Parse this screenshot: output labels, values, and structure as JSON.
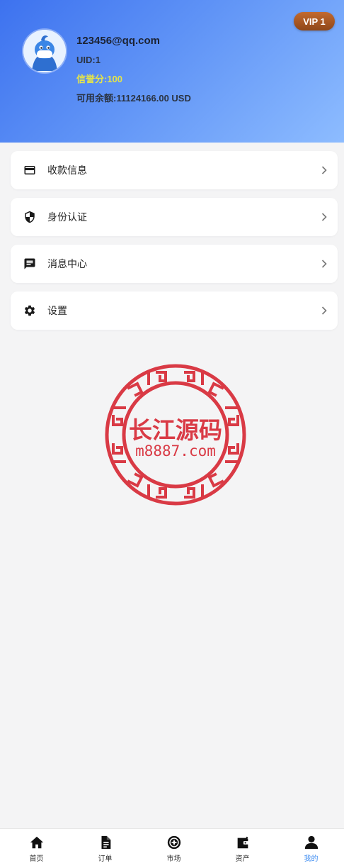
{
  "profile": {
    "vip_badge": "VIP 1",
    "email": "123456@qq.com",
    "uid": "UID:1",
    "credit": "信誉分:100",
    "balance": "可用余额:11124166.00 USD"
  },
  "menu": {
    "items": [
      {
        "label": "收款信息",
        "icon": "card-icon"
      },
      {
        "label": "身份认证",
        "icon": "shield-icon"
      },
      {
        "label": "消息中心",
        "icon": "message-icon"
      },
      {
        "label": "设置",
        "icon": "gear-icon"
      }
    ]
  },
  "watermark": {
    "title": "长江源码",
    "url": "m8887.com",
    "color": "#d93a45"
  },
  "nav": {
    "active_color": "#3c8bf1",
    "items": [
      {
        "label": "首页",
        "icon": "home-icon"
      },
      {
        "label": "订单",
        "icon": "document-icon"
      },
      {
        "label": "市场",
        "icon": "market-icon"
      },
      {
        "label": "资产",
        "icon": "wallet-icon"
      },
      {
        "label": "我的",
        "icon": "user-icon",
        "active": true
      }
    ]
  }
}
